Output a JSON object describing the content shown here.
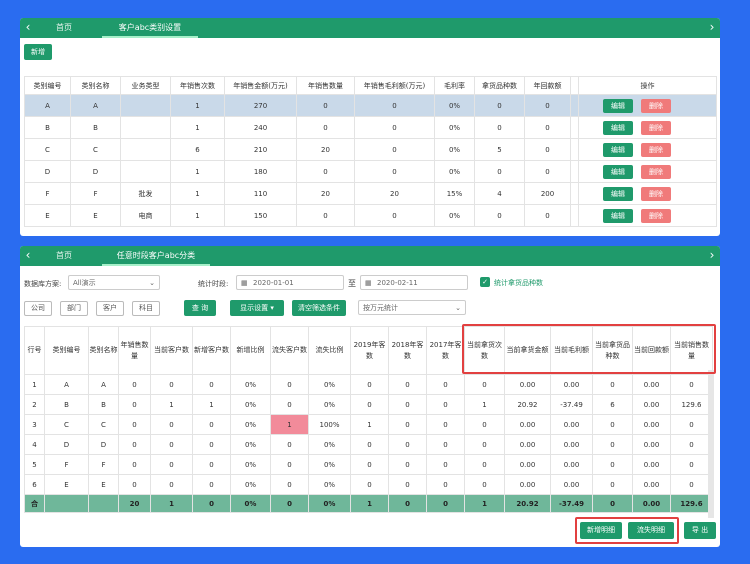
{
  "panel1": {
    "tabs": [
      "首页",
      "客户abc类别设置"
    ],
    "add_label": "新增",
    "headers": [
      "类别编号",
      "类别名称",
      "业务类型",
      "年销售次数",
      "年销售金额(万元)",
      "年销售数量",
      "年销售毛利额(万元)",
      "毛利率",
      "拿货品种数",
      "年回款额",
      "操作"
    ],
    "rows": [
      [
        "A",
        "A",
        "",
        "1",
        "270",
        "0",
        "0",
        "0%",
        "0",
        "0"
      ],
      [
        "B",
        "B",
        "",
        "1",
        "240",
        "0",
        "0",
        "0%",
        "0",
        "0"
      ],
      [
        "C",
        "C",
        "",
        "6",
        "210",
        "20",
        "0",
        "0%",
        "5",
        "0"
      ],
      [
        "D",
        "D",
        "",
        "1",
        "180",
        "0",
        "0",
        "0%",
        "0",
        "0"
      ],
      [
        "F",
        "F",
        "批发",
        "1",
        "110",
        "20",
        "20",
        "15%",
        "4",
        "200"
      ],
      [
        "E",
        "E",
        "电商",
        "1",
        "150",
        "0",
        "0",
        "0%",
        "0",
        "0"
      ]
    ],
    "edit_label": "编辑",
    "delete_label": "删除"
  },
  "panel2": {
    "tabs": [
      "首页",
      "任意时段客户abc分类"
    ],
    "scheme_label": "数据库方案:",
    "scheme_value": "All演示",
    "period_label": "统计时段:",
    "date_from": "2020-01-01",
    "date_sep": "至",
    "date_to": "2020-02-11",
    "check_label": "统计拿货品种数",
    "dims": [
      "公司",
      "部门",
      "客户",
      "科目"
    ],
    "query_label": "查 询",
    "show_label": "显示设置",
    "clear_label": "清空筛选条件",
    "unit_value": "按万元统计",
    "headers": [
      "行号",
      "类别编号",
      "类别名称",
      "年销售数量",
      "当前客户数",
      "新增客户数",
      "新增比例",
      "流失客户数",
      "流失比例",
      "2019年客数",
      "2018年客数",
      "2017年客数",
      "当前拿货次数",
      "当前拿货金额",
      "当前毛利额",
      "当前拿货品种数",
      "当前回款额",
      "当前销售数量"
    ],
    "rows": [
      [
        "1",
        "A",
        "A",
        "0",
        "0",
        "0",
        "0%",
        "0",
        "0%",
        "0",
        "0",
        "0",
        "0",
        "0.00",
        "0.00",
        "0",
        "0.00",
        "0"
      ],
      [
        "2",
        "B",
        "B",
        "0",
        "1",
        "1",
        "0%",
        "0",
        "0%",
        "0",
        "0",
        "0",
        "1",
        "20.92",
        "-37.49",
        "6",
        "0.00",
        "129.6"
      ],
      [
        "3",
        "C",
        "C",
        "0",
        "0",
        "0",
        "0%",
        "1",
        "100%",
        "1",
        "0",
        "0",
        "0",
        "0.00",
        "0.00",
        "0",
        "0.00",
        "0"
      ],
      [
        "4",
        "D",
        "D",
        "0",
        "0",
        "0",
        "0%",
        "0",
        "0%",
        "0",
        "0",
        "0",
        "0",
        "0.00",
        "0.00",
        "0",
        "0.00",
        "0"
      ],
      [
        "5",
        "F",
        "F",
        "0",
        "0",
        "0",
        "0%",
        "0",
        "0%",
        "0",
        "0",
        "0",
        "0",
        "0.00",
        "0.00",
        "0",
        "0.00",
        "0"
      ],
      [
        "6",
        "E",
        "E",
        "0",
        "0",
        "0",
        "0%",
        "0",
        "0%",
        "0",
        "0",
        "0",
        "0",
        "0.00",
        "0.00",
        "0",
        "0.00",
        "0"
      ]
    ],
    "total_row": [
      "合",
      "",
      "",
      "20",
      "1",
      "0",
      "0%",
      "0",
      "0%",
      "1",
      "0",
      "0",
      "1",
      "20.92",
      "-37.49",
      "0",
      "0.00",
      "129.6"
    ],
    "footer_buttons": [
      "新增明细",
      "流失明细",
      "导 出"
    ],
    "highlight_color": "#f28b9a"
  }
}
